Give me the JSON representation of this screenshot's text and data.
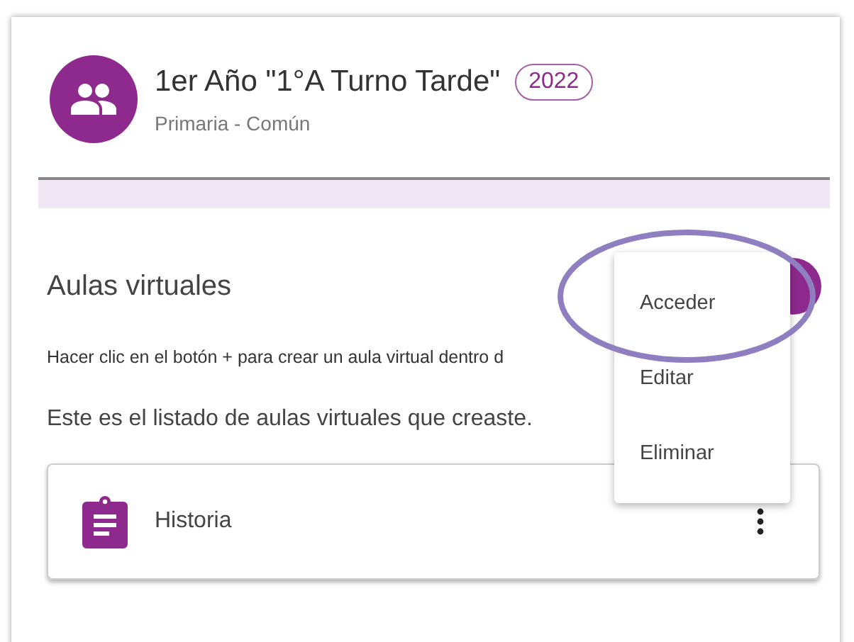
{
  "course": {
    "title": "1er Año \"1°A Turno Tarde\"",
    "year": "2022",
    "subtitle": "Primaria - Común"
  },
  "section": {
    "title": "Aulas virtuales",
    "hint": "Hacer clic en el botón + para crear un aula virtual dentro d",
    "intro": "Este es el listado de aulas virtuales que creaste."
  },
  "classrooms": [
    {
      "name": "Historia"
    }
  ],
  "menu": {
    "items": [
      {
        "label": "Acceder",
        "highlighted": true
      },
      {
        "label": "Editar",
        "highlighted": false
      },
      {
        "label": "Eliminar",
        "highlighted": false
      }
    ]
  }
}
